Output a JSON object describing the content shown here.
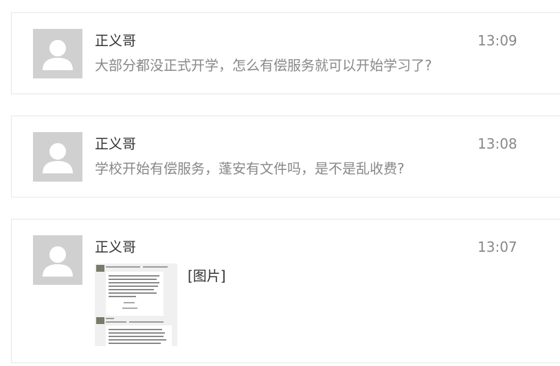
{
  "messages": [
    {
      "sender": "正义哥",
      "time": "13:09",
      "text": "大部分都没正式开学，怎么有偿服务就可以开始学习了?"
    },
    {
      "sender": "正义哥",
      "time": "13:08",
      "text": "学校开始有偿服务，蓬安有文件吗，是不是乱收费?"
    },
    {
      "sender": "正义哥",
      "time": "13:07",
      "image_label": "[图片]"
    }
  ],
  "icons": {
    "avatar": "default-user-avatar-icon",
    "thumbnail": "chat-screenshot-thumbnail"
  },
  "colors": {
    "border": "#e6e6e6",
    "avatar_bg": "#d0d0d0",
    "name": "#333333",
    "text_muted": "#888888"
  }
}
